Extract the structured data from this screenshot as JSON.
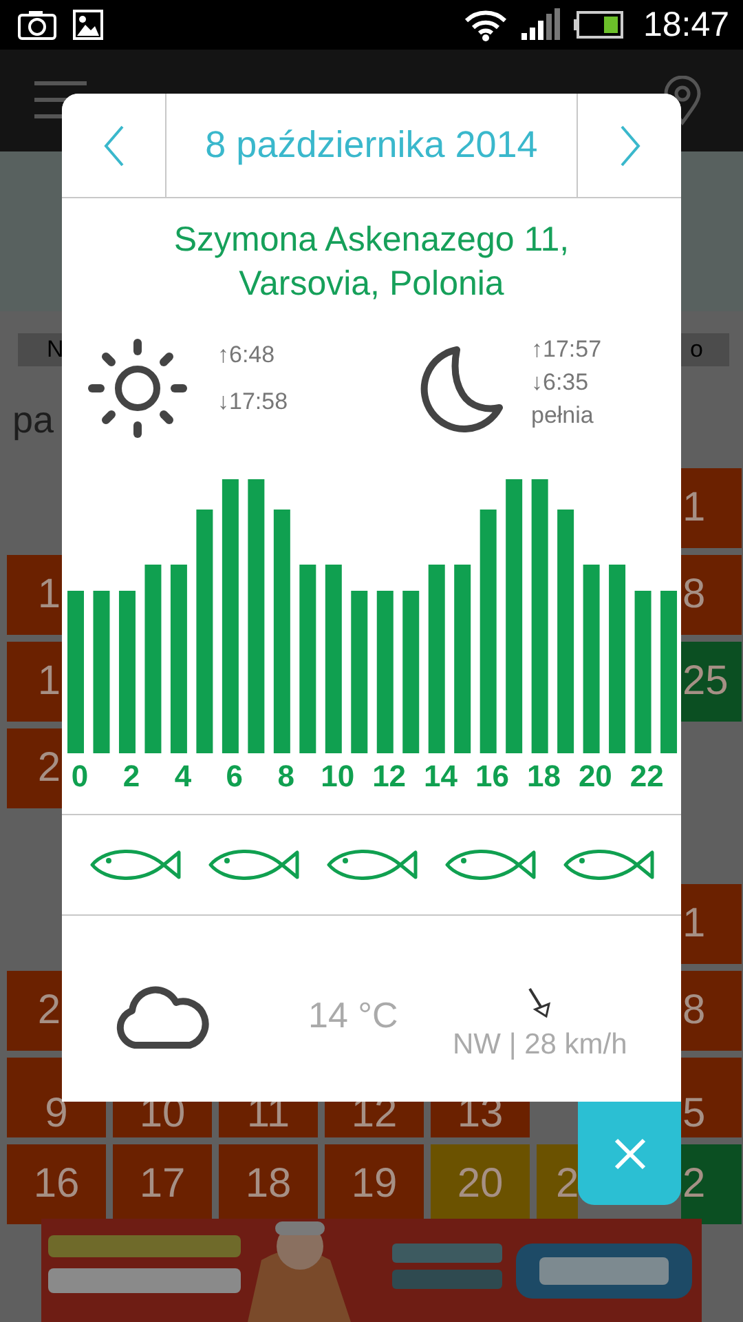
{
  "status_bar": {
    "time": "18:47"
  },
  "background": {
    "weekday_bar": {
      "left": "N",
      "right": "o"
    },
    "month_label": "pa",
    "calendar_rows": [
      [
        null,
        null,
        null,
        null,
        null,
        null,
        {
          "day": "1",
          "color": "#6b2100"
        }
      ],
      [
        {
          "day": "1",
          "color": "#6b2100"
        },
        null,
        null,
        null,
        null,
        null,
        {
          "day": "8",
          "color": "#6b2100"
        }
      ],
      [
        {
          "day": "1",
          "color": "#6b2100"
        },
        null,
        null,
        null,
        null,
        null,
        {
          "day": "25",
          "color": "#0b4f22"
        }
      ],
      [
        {
          "day": "2",
          "color": "#6b2100"
        },
        null,
        null,
        null,
        null,
        null,
        null
      ],
      [
        null,
        null,
        null,
        null,
        null,
        null,
        {
          "day": "1",
          "color": "#6b2100"
        }
      ],
      [
        {
          "day": "2",
          "color": "#6b2100"
        },
        null,
        null,
        null,
        null,
        null,
        {
          "day": "8",
          "color": "#6b2100"
        }
      ],
      [
        {
          "day": "9",
          "color": "#6b2100"
        },
        {
          "day": "10",
          "color": "#6b2100"
        },
        {
          "day": "11",
          "color": "#6b2100"
        },
        {
          "day": "12",
          "color": "#6b2100"
        },
        {
          "day": "13",
          "color": "#6b2100"
        },
        null,
        {
          "day": "5",
          "color": "#6b2100"
        }
      ],
      [
        {
          "day": "16",
          "color": "#6b2100"
        },
        {
          "day": "17",
          "color": "#6b2100"
        },
        {
          "day": "18",
          "color": "#6b2100"
        },
        {
          "day": "19",
          "color": "#6b2100"
        },
        {
          "day": "20",
          "color": "#6b5200"
        },
        {
          "day": "2",
          "color": "#6b5200"
        },
        {
          "day": "2",
          "color": "#0b4f22"
        }
      ]
    ]
  },
  "dialog": {
    "date": "8 października 2014",
    "address_lines": [
      "Szymona Askenazego 11,",
      "Varsovia, Polonia"
    ],
    "sun": {
      "rise": "↑6:48",
      "set": "↓17:58"
    },
    "moon": {
      "rise": "↑17:57",
      "set": "↓6:35",
      "phase": "pełnia"
    },
    "hour_labels": [
      "0",
      "2",
      "4",
      "6",
      "8",
      "10",
      "12",
      "14",
      "16",
      "18",
      "20",
      "22"
    ],
    "weather": {
      "temperature": "14 °C",
      "wind": "NW | 28 km/h"
    }
  }
}
